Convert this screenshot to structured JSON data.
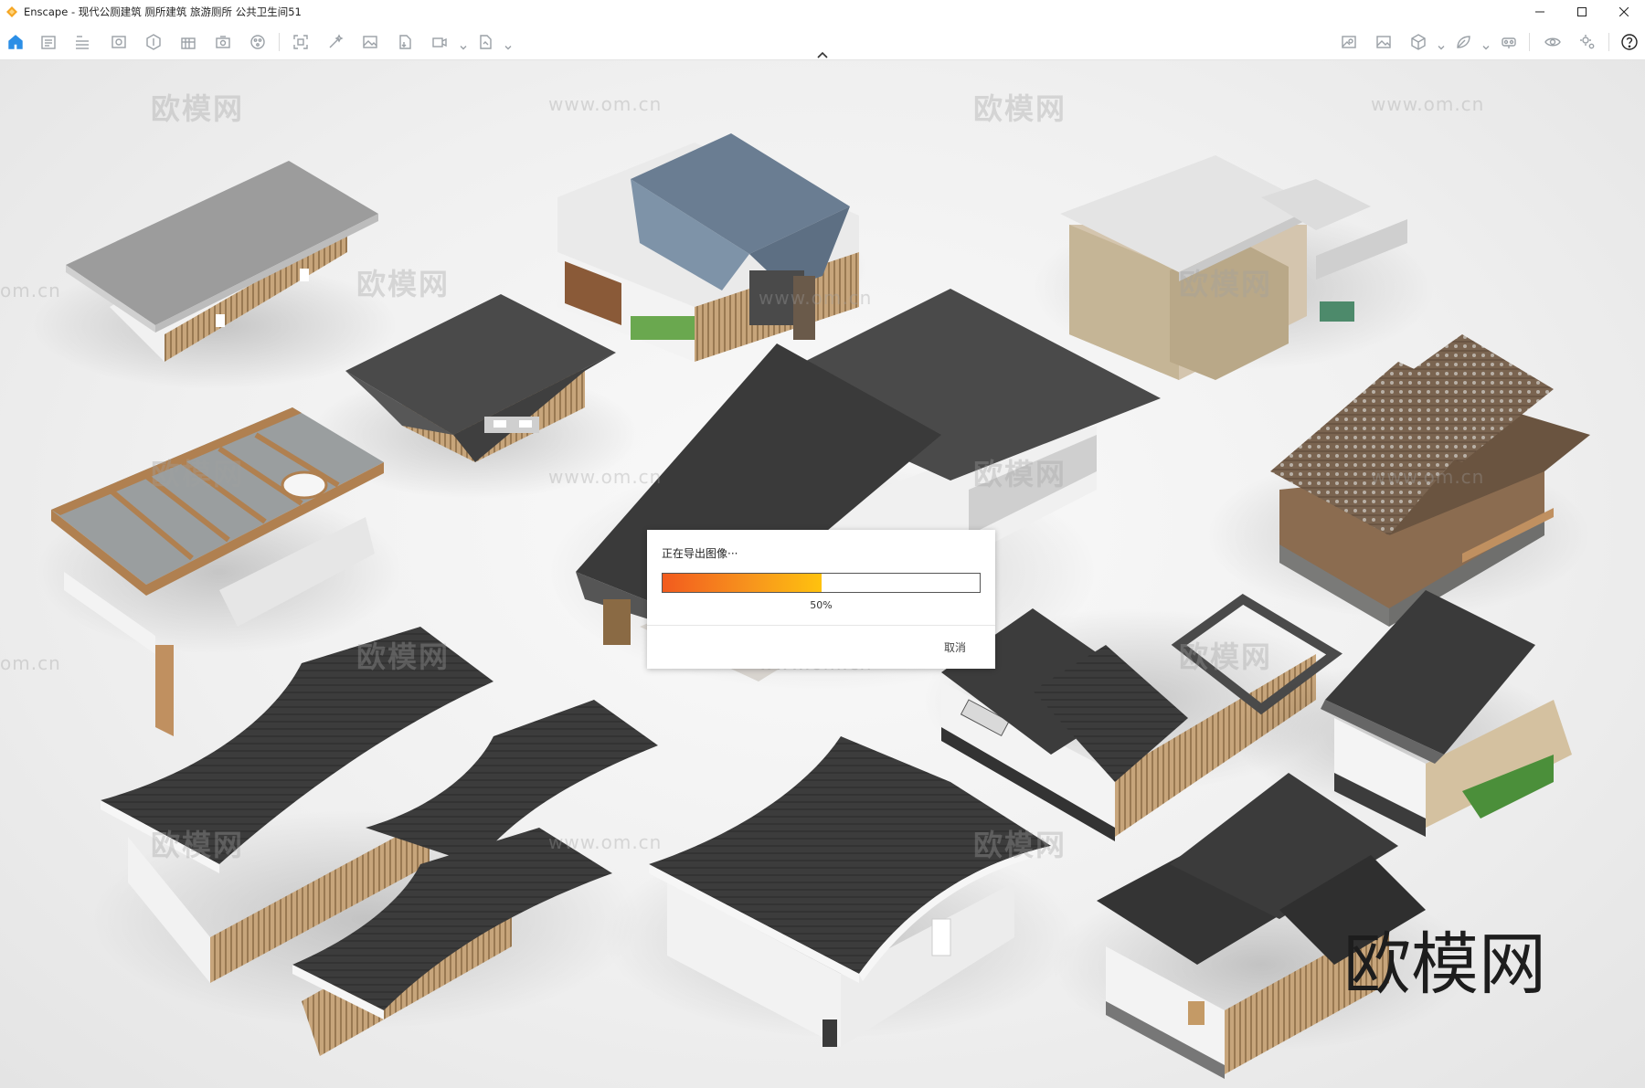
{
  "window": {
    "title": "Enscape - 现代公厕建筑 厕所建筑 旅游厕所 公共卫生间51",
    "controls": [
      "minimize",
      "maximize",
      "close"
    ]
  },
  "toolbar": {
    "left_icons": [
      "home-icon",
      "project-icon",
      "bim-icon",
      "view-icon",
      "asset-icon",
      "batch-icon",
      "capture-icon",
      "library-icon",
      "screenshot-icon",
      "magic-icon",
      "image-icon",
      "export-icon",
      "video-icon",
      "panorama-icon"
    ],
    "right_icons": [
      "settings-image-icon",
      "view-image-icon",
      "cube-icon",
      "leaf-icon",
      "vr-icon",
      "visibility-icon",
      "gear-icon",
      "help-icon"
    ],
    "accent_color": "#2b8ee6"
  },
  "viewport": {
    "watermarks": [
      "欧模网",
      "www.om.cn",
      "om.cn"
    ],
    "brand_watermark": "欧模网",
    "background_color": "#f2f2f2"
  },
  "export_dialog": {
    "title": "正在导出图像···",
    "progress": 0.5,
    "progress_label": "50%",
    "cancel_label": "取消"
  }
}
